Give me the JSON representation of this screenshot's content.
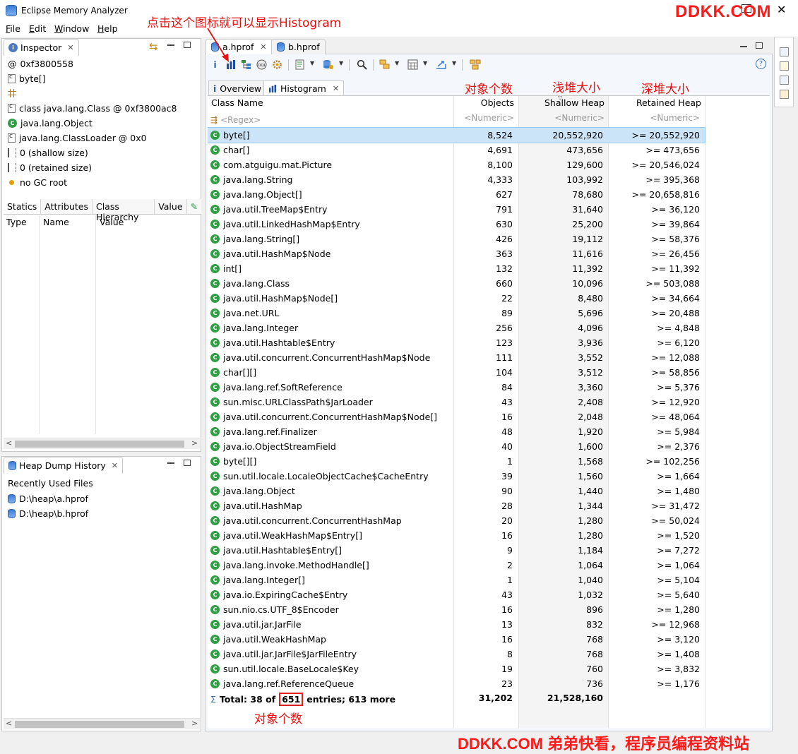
{
  "window": {
    "title": "Eclipse Memory Analyzer",
    "close_glyph": "✕"
  },
  "watermark": {
    "top": "DDKK.COM",
    "bottom": "DDKK.COM 弟弟快看，程序员编程资料站"
  },
  "menu": [
    {
      "label": "File",
      "mnemonic": "F",
      "rest": "ile"
    },
    {
      "label": "Edit",
      "mnemonic": "E",
      "rest": "dit"
    },
    {
      "label": "Window",
      "mnemonic": "W",
      "rest": "indow"
    },
    {
      "label": "Help",
      "mnemonic": "H",
      "rest": "elp"
    }
  ],
  "inspector": {
    "tab_label": "Inspector",
    "rows": [
      {
        "icon": "at-icon",
        "text": "0xf3800558"
      },
      {
        "icon": "class-file-icon",
        "text": "byte[]"
      },
      {
        "icon": "grid-icon",
        "text": ""
      },
      {
        "icon": "class-file-icon",
        "text": "class java.lang.Class @ 0xf3800ac8"
      },
      {
        "icon": "class-icon",
        "text": "java.lang.Object"
      },
      {
        "icon": "class-file-icon",
        "text": "java.lang.ClassLoader @ 0x0"
      },
      {
        "icon": "size-icon",
        "text": "0 (shallow size)"
      },
      {
        "icon": "size-icon",
        "text": "0 (retained size)"
      },
      {
        "icon": "gc-root-icon",
        "text": "no GC root"
      }
    ],
    "subtabs": [
      "Statics",
      "Attributes",
      "Class Hierarchy",
      "Value"
    ],
    "columns": [
      "Type",
      "Name",
      "Value"
    ]
  },
  "heap_history": {
    "tab_label": "Heap Dump History",
    "section_label": "Recently Used Files",
    "files": [
      "D:\\heap\\a.hprof",
      "D:\\heap\\b.hprof"
    ]
  },
  "editor": {
    "tabs": [
      "a.hprof",
      "b.hprof"
    ],
    "inner_tabs": [
      "Overview",
      "Histogram"
    ],
    "help_glyph": "?"
  },
  "histogram": {
    "headers": {
      "name": "Class Name",
      "objects": "Objects",
      "shallow": "Shallow Heap",
      "retained": "Retained Heap"
    },
    "filters": {
      "name": "<Regex>",
      "objects": "<Numeric>",
      "shallow": "<Numeric>",
      "retained": "<Numeric>"
    },
    "rows": [
      {
        "name": "byte[]",
        "objects": "8,524",
        "shallow": "20,552,920",
        "retained": ">= 20,552,920"
      },
      {
        "name": "char[]",
        "objects": "4,691",
        "shallow": "473,656",
        "retained": ">= 473,656"
      },
      {
        "name": "com.atguigu.mat.Picture",
        "objects": "8,100",
        "shallow": "129,600",
        "retained": ">= 20,546,024"
      },
      {
        "name": "java.lang.String",
        "objects": "4,333",
        "shallow": "103,992",
        "retained": ">= 395,368"
      },
      {
        "name": "java.lang.Object[]",
        "objects": "627",
        "shallow": "78,680",
        "retained": ">= 20,658,816"
      },
      {
        "name": "java.util.TreeMap$Entry",
        "objects": "791",
        "shallow": "31,640",
        "retained": ">= 36,120"
      },
      {
        "name": "java.util.LinkedHashMap$Entry",
        "objects": "630",
        "shallow": "25,200",
        "retained": ">= 39,864"
      },
      {
        "name": "java.lang.String[]",
        "objects": "426",
        "shallow": "19,112",
        "retained": ">= 58,376"
      },
      {
        "name": "java.util.HashMap$Node",
        "objects": "363",
        "shallow": "11,616",
        "retained": ">= 26,456"
      },
      {
        "name": "int[]",
        "objects": "132",
        "shallow": "11,392",
        "retained": ">= 11,392"
      },
      {
        "name": "java.lang.Class",
        "objects": "660",
        "shallow": "10,096",
        "retained": ">= 503,088"
      },
      {
        "name": "java.util.HashMap$Node[]",
        "objects": "22",
        "shallow": "8,480",
        "retained": ">= 34,664"
      },
      {
        "name": "java.net.URL",
        "objects": "89",
        "shallow": "5,696",
        "retained": ">= 20,488"
      },
      {
        "name": "java.lang.Integer",
        "objects": "256",
        "shallow": "4,096",
        "retained": ">= 4,848"
      },
      {
        "name": "java.util.Hashtable$Entry",
        "objects": "123",
        "shallow": "3,936",
        "retained": ">= 6,120"
      },
      {
        "name": "java.util.concurrent.ConcurrentHashMap$Node",
        "objects": "111",
        "shallow": "3,552",
        "retained": ">= 12,088"
      },
      {
        "name": "char[][]",
        "objects": "104",
        "shallow": "3,512",
        "retained": ">= 58,856"
      },
      {
        "name": "java.lang.ref.SoftReference",
        "objects": "84",
        "shallow": "3,360",
        "retained": ">= 5,376"
      },
      {
        "name": "sun.misc.URLClassPath$JarLoader",
        "objects": "43",
        "shallow": "2,408",
        "retained": ">= 12,920"
      },
      {
        "name": "java.util.concurrent.ConcurrentHashMap$Node[]",
        "objects": "16",
        "shallow": "2,048",
        "retained": ">= 48,064"
      },
      {
        "name": "java.lang.ref.Finalizer",
        "objects": "48",
        "shallow": "1,920",
        "retained": ">= 5,984"
      },
      {
        "name": "java.io.ObjectStreamField",
        "objects": "40",
        "shallow": "1,600",
        "retained": ">= 2,376"
      },
      {
        "name": "byte[][]",
        "objects": "1",
        "shallow": "1,568",
        "retained": ">= 102,256"
      },
      {
        "name": "sun.util.locale.LocaleObjectCache$CacheEntry",
        "objects": "39",
        "shallow": "1,560",
        "retained": ">= 1,664"
      },
      {
        "name": "java.lang.Object",
        "objects": "90",
        "shallow": "1,440",
        "retained": ">= 1,480"
      },
      {
        "name": "java.util.HashMap",
        "objects": "28",
        "shallow": "1,344",
        "retained": ">= 31,472"
      },
      {
        "name": "java.util.concurrent.ConcurrentHashMap",
        "objects": "20",
        "shallow": "1,280",
        "retained": ">= 50,024"
      },
      {
        "name": "java.util.WeakHashMap$Entry[]",
        "objects": "16",
        "shallow": "1,280",
        "retained": ">= 1,520"
      },
      {
        "name": "java.util.Hashtable$Entry[]",
        "objects": "9",
        "shallow": "1,184",
        "retained": ">= 7,272"
      },
      {
        "name": "java.lang.invoke.MethodHandle[]",
        "objects": "2",
        "shallow": "1,064",
        "retained": ">= 1,064"
      },
      {
        "name": "java.lang.Integer[]",
        "objects": "1",
        "shallow": "1,040",
        "retained": ">= 5,104"
      },
      {
        "name": "java.io.ExpiringCache$Entry",
        "objects": "43",
        "shallow": "1,032",
        "retained": ">= 5,640"
      },
      {
        "name": "sun.nio.cs.UTF_8$Encoder",
        "objects": "16",
        "shallow": "896",
        "retained": ">= 1,280"
      },
      {
        "name": "java.util.jar.JarFile",
        "objects": "13",
        "shallow": "832",
        "retained": ">= 12,968"
      },
      {
        "name": "java.util.WeakHashMap",
        "objects": "16",
        "shallow": "768",
        "retained": ">= 3,120"
      },
      {
        "name": "java.util.jar.JarFile$JarFileEntry",
        "objects": "8",
        "shallow": "768",
        "retained": ">= 1,408"
      },
      {
        "name": "sun.util.locale.BaseLocale$Key",
        "objects": "19",
        "shallow": "760",
        "retained": ">= 3,832"
      },
      {
        "name": "java.lang.ref.ReferenceQueue",
        "objects": "23",
        "shallow": "736",
        "retained": ">= 1,176"
      }
    ],
    "total": {
      "prefix": "Total: 38 of",
      "count": "651",
      "suffix": "entries; 613 more",
      "objects": "31,202",
      "shallow": "21,528,160"
    }
  },
  "annotations": {
    "histogram_hint": "点击这个图标就可以显示Histogram",
    "objects_count": "对象个数",
    "shallow_heap": "浅堆大小",
    "retained_heap": "深堆大小",
    "objects_count_bottom": "对象个数"
  },
  "colors": {
    "annotation": "#e81010",
    "selection": "#cce4f7",
    "class_icon": "#2f9e44"
  }
}
